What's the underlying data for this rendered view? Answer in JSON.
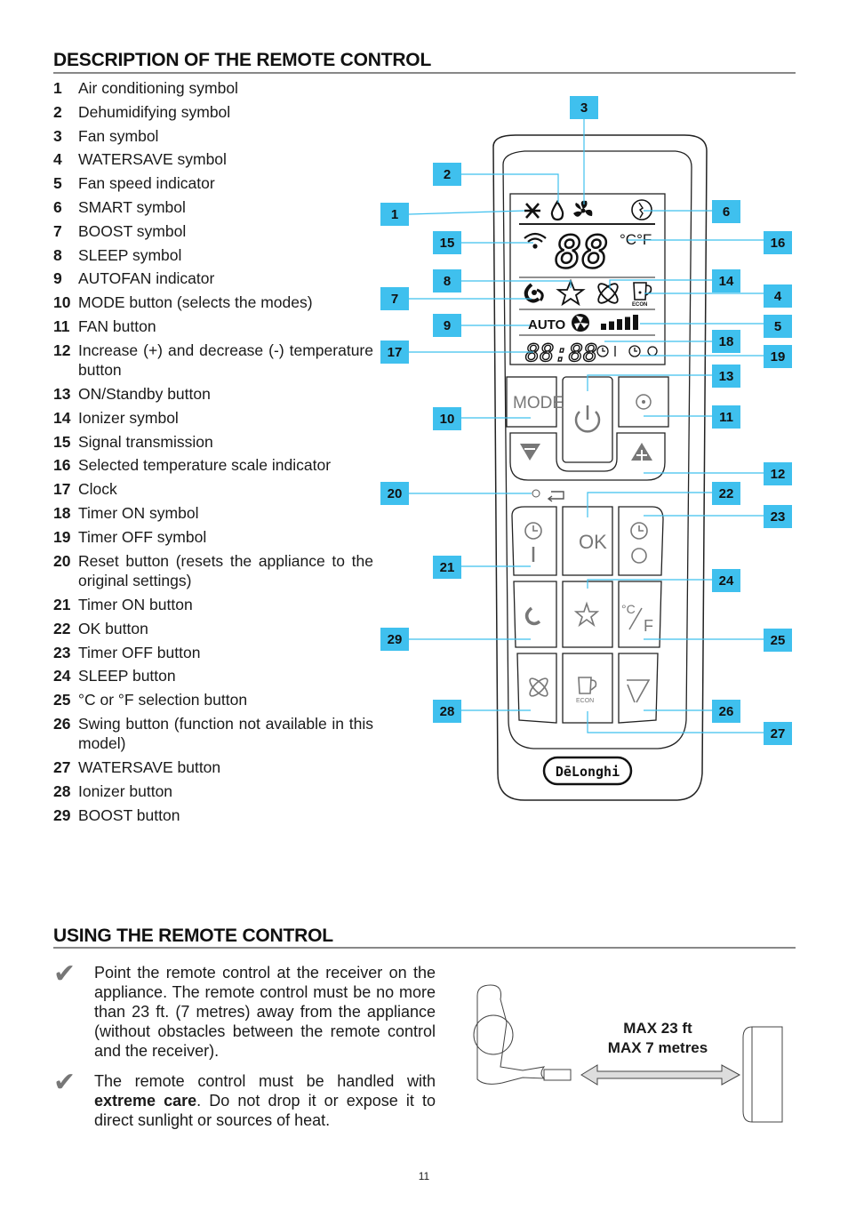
{
  "sections": {
    "description_title": "DESCRIPTION OF THE REMOTE CONTROL",
    "using_title": "USING THE REMOTE CONTROL"
  },
  "items": [
    {
      "n": "1",
      "label": "Air conditioning symbol"
    },
    {
      "n": "2",
      "label": "Dehumidifying symbol"
    },
    {
      "n": "3",
      "label": "Fan symbol"
    },
    {
      "n": "4",
      "label": "WATERSAVE symbol"
    },
    {
      "n": "5",
      "label": "Fan speed indicator"
    },
    {
      "n": "6",
      "label": "SMART symbol"
    },
    {
      "n": "7",
      "label": "BOOST symbol"
    },
    {
      "n": "8",
      "label": "SLEEP symbol"
    },
    {
      "n": "9",
      "label": "AUTOFAN indicator"
    },
    {
      "n": "10",
      "label": "MODE button (selects the modes)"
    },
    {
      "n": "11",
      "label": "FAN button"
    },
    {
      "n": "12",
      "label": "Increase (+) and decrease (-) temperature button"
    },
    {
      "n": "13",
      "label": "ON/Standby button"
    },
    {
      "n": "14",
      "label": "Ionizer symbol"
    },
    {
      "n": "15",
      "label": "Signal transmission"
    },
    {
      "n": "16",
      "label": "Selected temperature scale indicator"
    },
    {
      "n": "17",
      "label": "Clock"
    },
    {
      "n": "18",
      "label": "Timer ON symbol"
    },
    {
      "n": "19",
      "label": "Timer OFF symbol"
    },
    {
      "n": "20",
      "label": "Reset button (resets the appliance to the original settings)"
    },
    {
      "n": "21",
      "label": "Timer ON button"
    },
    {
      "n": "22",
      "label": "OK button"
    },
    {
      "n": "23",
      "label": "Timer OFF  button"
    },
    {
      "n": "24",
      "label": "SLEEP button"
    },
    {
      "n": "25",
      "label": "°C or °F selection button"
    },
    {
      "n": "26",
      "label": "Swing button (function not available in this model)"
    },
    {
      "n": "27",
      "label": "WATERSAVE button"
    },
    {
      "n": "28",
      "label": "Ionizer button"
    },
    {
      "n": "29",
      "label": "BOOST button"
    }
  ],
  "remote": {
    "display_temp": "88",
    "display_units": "°C°F",
    "display_auto": "AUTO",
    "display_clock": "88:88",
    "mode_label": "MODE",
    "ok_label": "OK",
    "econ_label": "ECON",
    "brand": "DēLonghi",
    "fan_speed_bars": 5
  },
  "callouts": [
    "1",
    "2",
    "3",
    "4",
    "5",
    "6",
    "7",
    "8",
    "9",
    "10",
    "11",
    "12",
    "13",
    "14",
    "15",
    "16",
    "17",
    "18",
    "19",
    "20",
    "21",
    "22",
    "23",
    "24",
    "25",
    "26",
    "27",
    "28",
    "29"
  ],
  "colors": {
    "callout": "#3fc0ee",
    "leader": "#3fc0ee"
  },
  "usage": {
    "bullet1": "Point the remote control at the receiver on the appliance.  The remote control must be no more than  23 ft. (7 metres) away from the appliance (without obstacles between the remote control and the receiver).",
    "bullet2_bold": "extreme care",
    "bullet2_pre": "The remote control must be handled with ",
    "bullet2_post": ". Do not drop it or expose it to direct sunlight or sources of heat."
  },
  "distance": {
    "line1": "MAX 23 ft",
    "line2": "MAX 7 metres"
  },
  "page_number": "11"
}
